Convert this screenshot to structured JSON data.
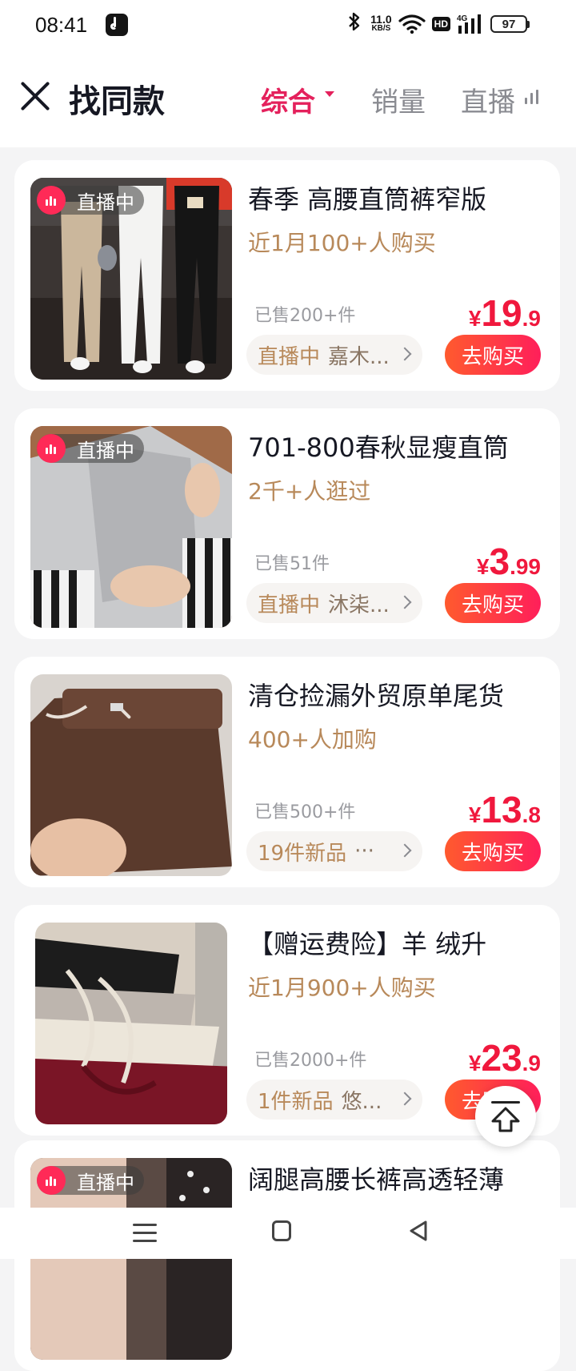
{
  "status_bar": {
    "time": "08:41",
    "net_speed_value": "11.0",
    "net_speed_unit": "KB/S",
    "hd_label": "HD",
    "network_label": "4G",
    "battery_level": "97"
  },
  "header": {
    "title": "找同款",
    "tabs": [
      {
        "label": "综合",
        "active": true
      },
      {
        "label": "销量",
        "active": false
      },
      {
        "label": "直播",
        "active": false
      }
    ]
  },
  "products": [
    {
      "title": "春季 高腰直筒裤窄版",
      "social": "近1月100+人购买",
      "sold": "已售200+件",
      "price_currency": "¥",
      "price_int": "19",
      "price_dec": ".9",
      "live_badge": "直播中",
      "chip_tag": "直播中",
      "chip_name": "嘉木...",
      "buy_label": "去购买"
    },
    {
      "title": "701-800春秋显瘦直筒",
      "social": "2千+人逛过",
      "sold": "已售51件",
      "price_currency": "¥",
      "price_int": "3",
      "price_dec": ".99",
      "live_badge": "直播中",
      "chip_tag": "直播中",
      "chip_name": "沐柒...",
      "buy_label": "去购买"
    },
    {
      "title": "清仓捡漏外贸原单尾货",
      "social": "400+人加购",
      "sold": "已售500+件",
      "price_currency": "¥",
      "price_int": "13",
      "price_dec": ".8",
      "live_badge": "",
      "chip_tag": "19件新品",
      "chip_name": "···",
      "buy_label": "去购买"
    },
    {
      "title": "【赠运费险】羊 绒升",
      "social": "近1月900+人购买",
      "sold": "已售2000+件",
      "price_currency": "¥",
      "price_int": "23",
      "price_dec": ".9",
      "live_badge": "",
      "chip_tag": "1件新品",
      "chip_name": "悠...",
      "buy_label": "去购买"
    },
    {
      "title": "阔腿高腰长裤高透轻薄",
      "live_badge": "直播中"
    }
  ],
  "icons": {
    "close": "close-icon",
    "back_to_top": "back-to-top-icon",
    "nav": [
      "menu-icon",
      "home-icon",
      "back-icon"
    ]
  },
  "colors": {
    "accent": "#e4215c",
    "price": "#f0183d",
    "social_text": "#b8895a",
    "buy_button": "#ff1f5a"
  }
}
